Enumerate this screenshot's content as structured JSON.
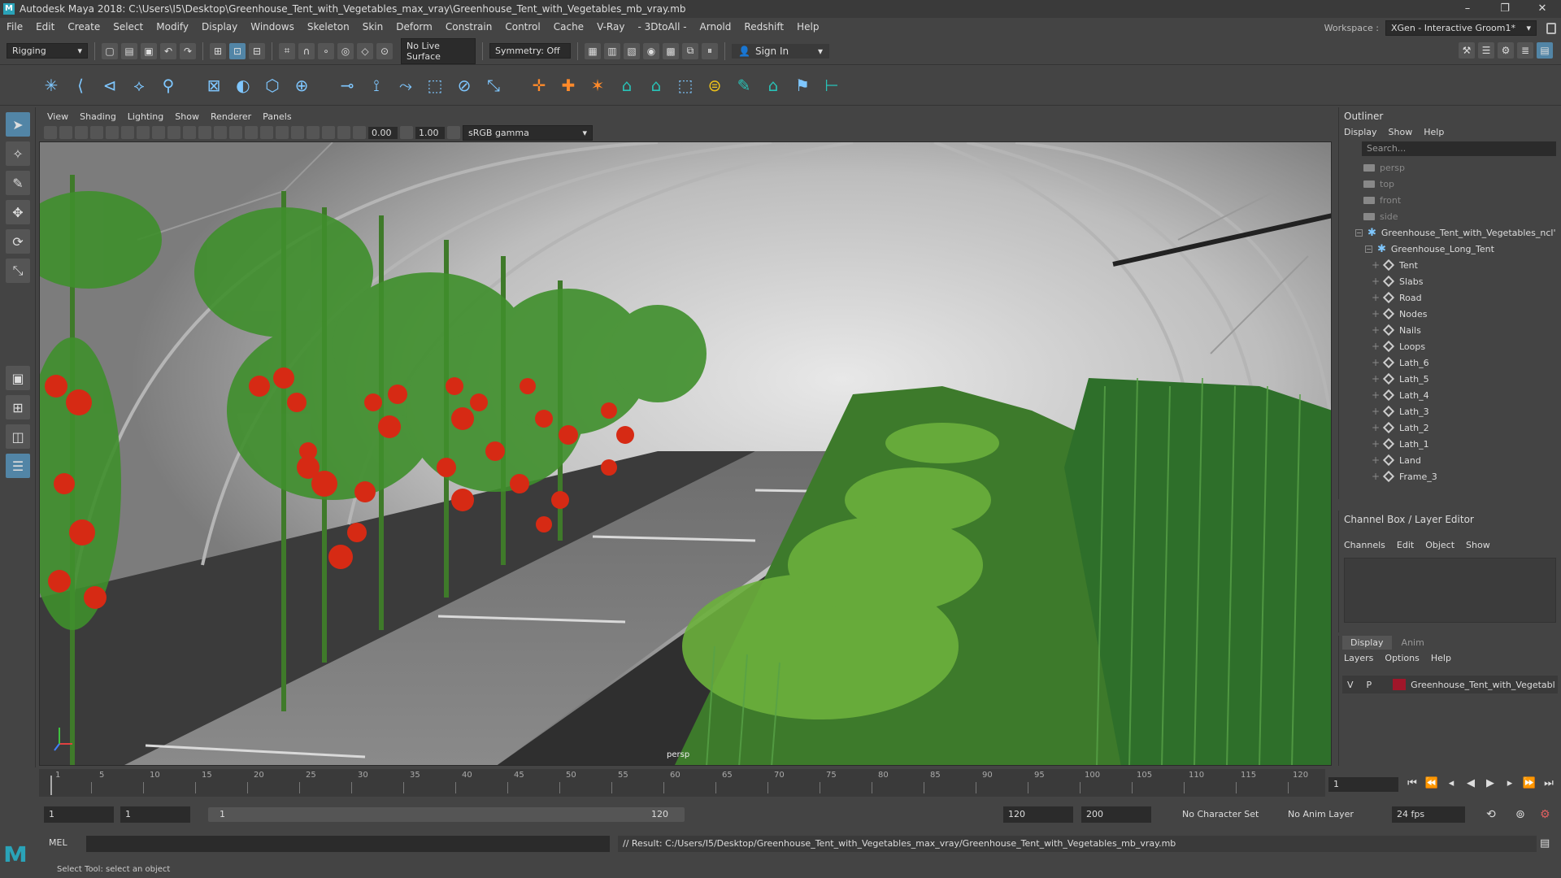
{
  "window": {
    "title": "Autodesk Maya 2018: C:\\Users\\I5\\Desktop\\Greenhouse_Tent_with_Vegetables_max_vray\\Greenhouse_Tent_with_Vegetables_mb_vray.mb",
    "minimize": "–",
    "maximize": "❐",
    "close": "✕"
  },
  "menus": [
    "File",
    "Edit",
    "Create",
    "Select",
    "Modify",
    "Display",
    "Windows",
    "Skeleton",
    "Skin",
    "Deform",
    "Constrain",
    "Control",
    "Cache",
    "V-Ray",
    "- 3DtoAll -",
    "Arnold",
    "Redshift",
    "Help"
  ],
  "workspace": {
    "label": "Workspace :",
    "value": "XGen - Interactive Groom1*"
  },
  "statusline": {
    "mode": "Rigging",
    "live_surface": "No Live Surface",
    "symmetry": "Symmetry: Off",
    "sign_in": "Sign In"
  },
  "viewport": {
    "menu": [
      "View",
      "Shading",
      "Lighting",
      "Show",
      "Renderer",
      "Panels"
    ],
    "exposure": "0.00",
    "gamma": "1.00",
    "color_space": "sRGB gamma",
    "camera_label": "persp"
  },
  "outliner": {
    "title": "Outliner",
    "menu": [
      "Display",
      "Show",
      "Help"
    ],
    "search_placeholder": "Search...",
    "cameras": [
      "persp",
      "top",
      "front",
      "side"
    ],
    "root": "Greenhouse_Tent_with_Vegetables_ncl'",
    "group": "Greenhouse_Long_Tent",
    "children": [
      "Tent",
      "Slabs",
      "Road",
      "Nodes",
      "Nails",
      "Loops",
      "Lath_6",
      "Lath_5",
      "Lath_4",
      "Lath_3",
      "Lath_2",
      "Lath_1",
      "Land",
      "Frame_3"
    ]
  },
  "channelbox": {
    "title": "Channel Box / Layer Editor",
    "menu": [
      "Channels",
      "Edit",
      "Object",
      "Show"
    ]
  },
  "layers": {
    "tabs": [
      "Display",
      "Anim"
    ],
    "menu": [
      "Layers",
      "Options",
      "Help"
    ],
    "layer": {
      "v": "V",
      "p": "P",
      "name": "Greenhouse_Tent_with_Vegetabl",
      "color": "#a0162a"
    }
  },
  "timeline": {
    "ticks": [
      "5",
      "10",
      "15",
      "20",
      "25",
      "30",
      "35",
      "40",
      "45",
      "50",
      "55",
      "60",
      "65",
      "70",
      "75",
      "80",
      "85",
      "90",
      "95",
      "100",
      "105",
      "110",
      "115",
      "120"
    ],
    "start_marker": "1",
    "current_frame": "1",
    "range_start": "1",
    "playback_start": "1",
    "slider_start": "1",
    "slider_end": "120",
    "playback_end": "120",
    "range_end": "200",
    "character_set": "No Character Set",
    "anim_layer": "No Anim Layer",
    "fps": "24 fps"
  },
  "command": {
    "label": "MEL",
    "result": "// Result: C:/Users/I5/Desktop/Greenhouse_Tent_with_Vegetables_max_vray/Greenhouse_Tent_with_Vegetables_mb_vray.mb"
  },
  "helpline": "Select Tool: select an object"
}
